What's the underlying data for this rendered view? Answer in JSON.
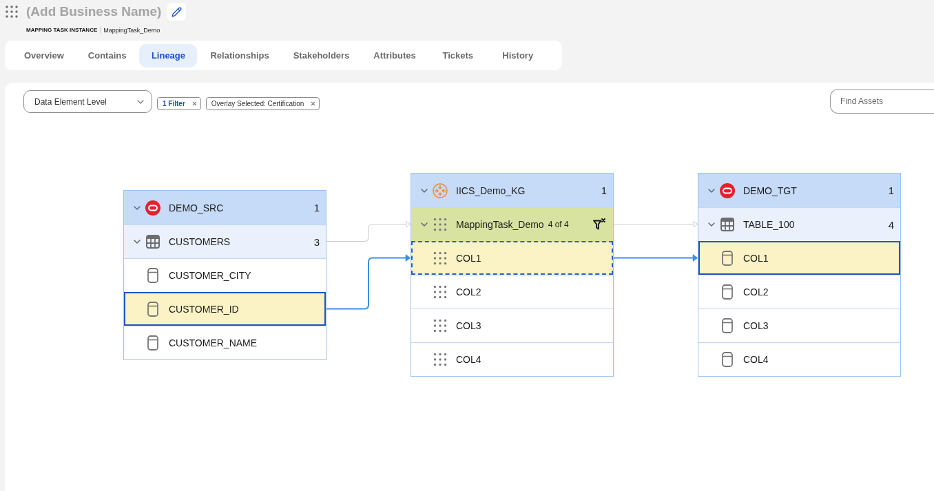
{
  "header": {
    "title": "(Add Business Name)",
    "asset_type": "MAPPING TASK INSTANCE",
    "asset_name": "MappingTask_Demo"
  },
  "tabs": [
    {
      "label": "Overview",
      "selected": false
    },
    {
      "label": "Contains",
      "selected": false
    },
    {
      "label": "Lineage",
      "selected": true
    },
    {
      "label": "Relationships",
      "selected": false
    },
    {
      "label": "Stakeholders",
      "selected": false
    },
    {
      "label": "Attributes",
      "selected": false
    },
    {
      "label": "Tickets",
      "selected": false
    },
    {
      "label": "History",
      "selected": false
    }
  ],
  "toolbar": {
    "level_select": "Data Element Level",
    "chips": [
      {
        "kind": "filter",
        "label": "1 Filter"
      },
      {
        "kind": "overlay",
        "label": "Overlay Selected: Certification"
      }
    ],
    "search": {
      "placeholder": "Find Assets"
    }
  },
  "lineage": {
    "nodes": [
      {
        "rows": [
          {
            "kind": "database",
            "label": "DEMO_SRC",
            "count": "1",
            "expanded": true
          },
          {
            "kind": "table",
            "label": "CUSTOMERS",
            "count": "3",
            "expanded": true,
            "link_out": true
          },
          {
            "kind": "column",
            "label": "CUSTOMER_CITY",
            "selected": false
          },
          {
            "kind": "column",
            "label": "CUSTOMER_ID",
            "selected": true,
            "link_out": true
          },
          {
            "kind": "column",
            "label": "CUSTOMER_NAME",
            "selected": false
          }
        ]
      },
      {
        "rows": [
          {
            "kind": "service",
            "label": "IICS_Demo_KG",
            "count": "1",
            "expanded": true
          },
          {
            "kind": "mapping",
            "label": "MappingTask_Demo",
            "count": "4 of 4",
            "expanded": true,
            "link_in": true,
            "link_out": true
          },
          {
            "kind": "field",
            "label": "COL1",
            "selected": true,
            "link_in": true,
            "link_out": true
          },
          {
            "kind": "field",
            "label": "COL2",
            "selected": false
          },
          {
            "kind": "field",
            "label": "COL3",
            "selected": false
          },
          {
            "kind": "field",
            "label": "COL4",
            "selected": false
          }
        ]
      },
      {
        "rows": [
          {
            "kind": "database",
            "label": "DEMO_TGT",
            "count": "1",
            "expanded": true
          },
          {
            "kind": "table",
            "label": "TABLE_100",
            "count": "4",
            "expanded": true,
            "link_in": true
          },
          {
            "kind": "column",
            "label": "COL1",
            "selected": true,
            "link_in": true
          },
          {
            "kind": "column",
            "label": "COL2",
            "selected": false
          },
          {
            "kind": "column",
            "label": "COL3",
            "selected": false
          },
          {
            "kind": "column",
            "label": "COL4",
            "selected": false
          }
        ]
      }
    ]
  }
}
